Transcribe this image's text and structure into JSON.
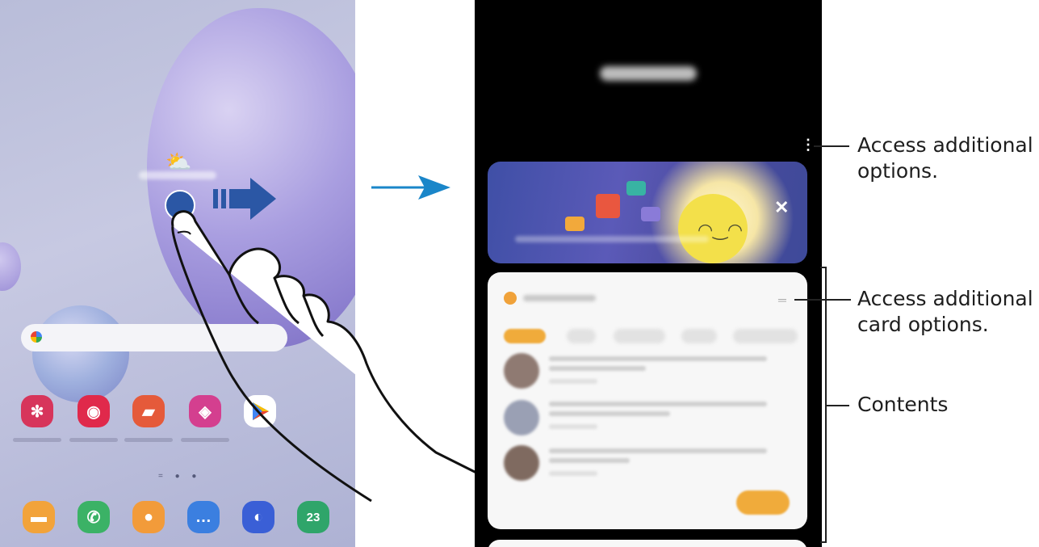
{
  "home_screen": {
    "apps_row": [
      {
        "icon": "bixby-icon",
        "color": "#d7355b"
      },
      {
        "icon": "camera-icon",
        "color": "#e0294b"
      },
      {
        "icon": "notes-icon",
        "color": "#e55a3a"
      },
      {
        "icon": "store-icon",
        "color": "#d43f8f"
      },
      {
        "icon": "play-store-icon",
        "color": "#ffffff"
      }
    ],
    "dock": [
      {
        "icon": "folder-icon",
        "color": "#f2a33a"
      },
      {
        "icon": "phone-icon",
        "color": "#3bb266"
      },
      {
        "icon": "contacts-icon",
        "color": "#f29b3a"
      },
      {
        "icon": "messages-icon",
        "color": "#3b7fe0"
      },
      {
        "icon": "internet-icon",
        "color": "#3a5fd6"
      },
      {
        "icon": "calendar-icon",
        "color": "#2fa56a",
        "label": "23"
      }
    ]
  },
  "accent_color": "#1a86c9",
  "feed": {
    "more_icon": "⋮",
    "close_icon": "✕"
  },
  "callouts": {
    "options": "Access additional\noptions.",
    "card_options": "Access additional\ncard options.",
    "contents": "Contents"
  }
}
